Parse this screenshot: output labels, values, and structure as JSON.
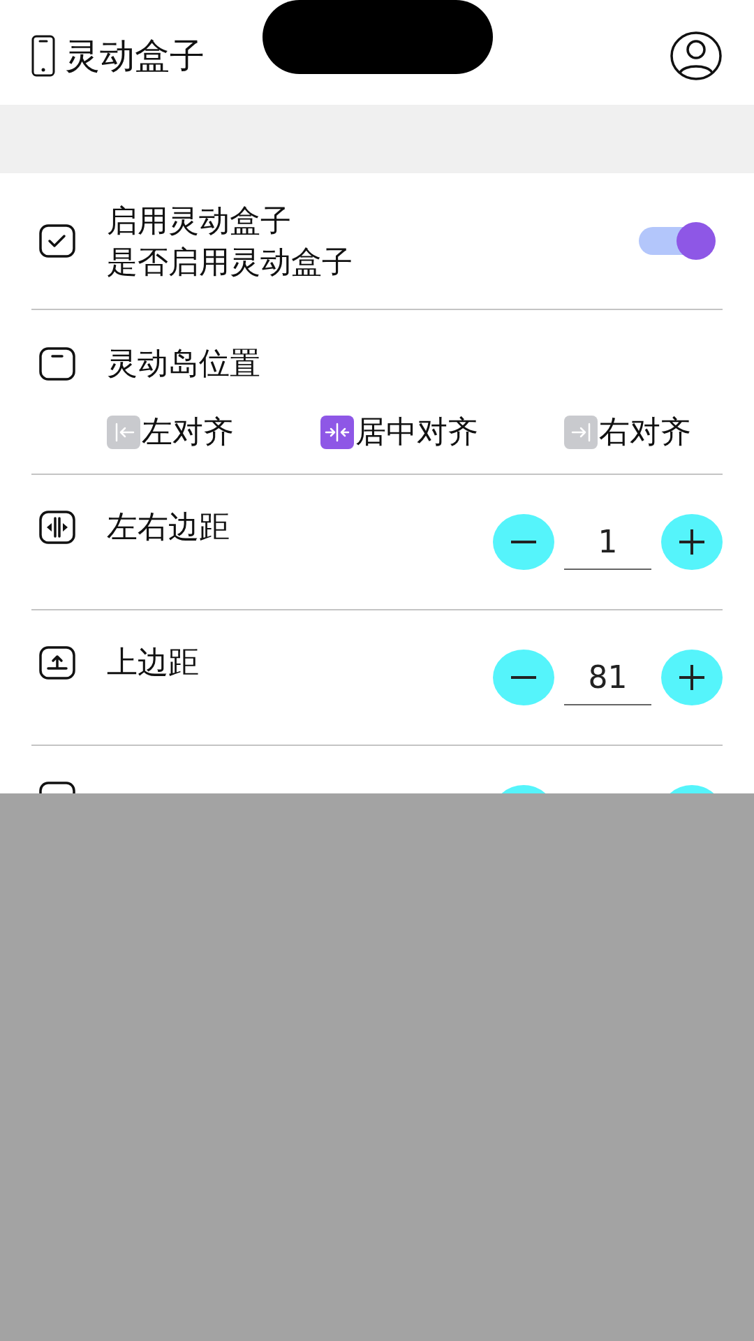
{
  "app_bar": {
    "title": "灵动盒子"
  },
  "settings": [
    {
      "kind": "toggle",
      "title": "启用灵动盒子",
      "subtitle": "是否启用灵动盒子",
      "on": true
    },
    {
      "kind": "choice",
      "title": "灵动岛位置",
      "options": [
        {
          "label": "左对齐",
          "selected": false
        },
        {
          "label": "居中对齐",
          "selected": true
        },
        {
          "label": "右对齐",
          "selected": false
        }
      ]
    },
    {
      "kind": "stepper",
      "title": "左右边距",
      "value": "1"
    },
    {
      "kind": "stepper",
      "title": "上边距",
      "value": "81"
    },
    {
      "kind": "stepper"
    }
  ]
}
